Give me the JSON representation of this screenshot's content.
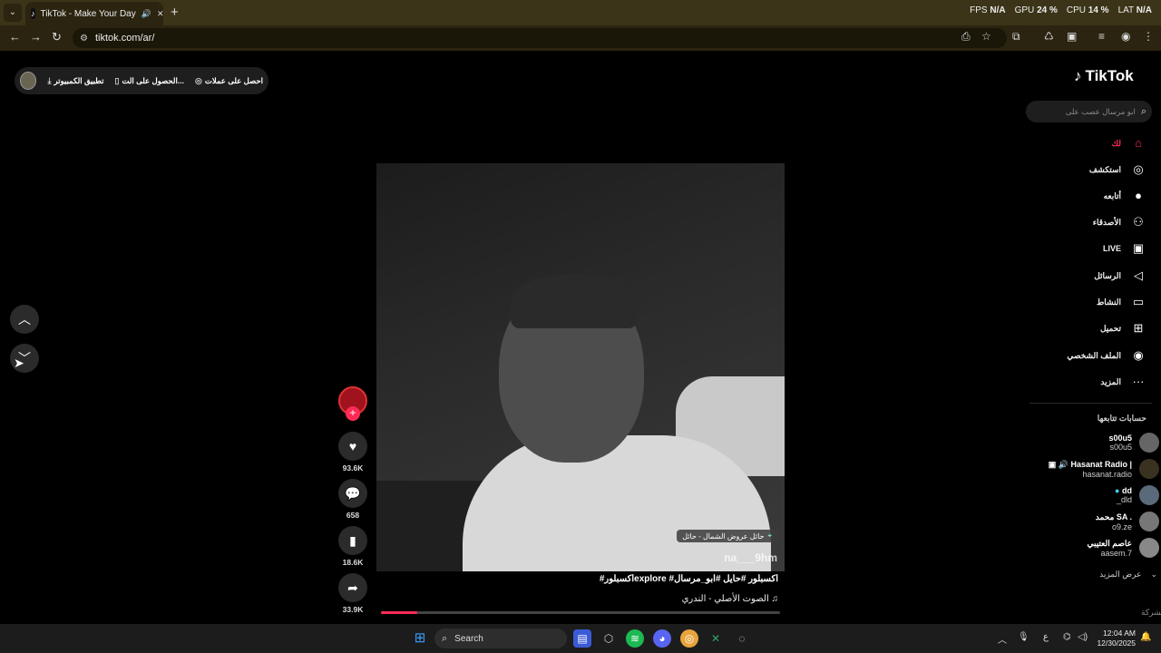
{
  "browser": {
    "tab_title": "TikTok - Make Your Day",
    "url": "tiktok.com/ar/",
    "perf": [
      {
        "label": "FPS",
        "value": "N/A"
      },
      {
        "label": "GPU",
        "value": "24 %"
      },
      {
        "label": "CPU",
        "value": "14 %"
      },
      {
        "label": "LAT",
        "value": "N/A"
      }
    ]
  },
  "top_actions": {
    "desktop_app": "تطبيق الكمبيوتر",
    "get_app": "الحصول على الت...",
    "get_coins": "احصل على عملات"
  },
  "sidebar": {
    "logo": "TikTok",
    "search_placeholder": "ابو مرسال عصب على",
    "nav": [
      {
        "label": "لك",
        "icon": "home-icon"
      },
      {
        "label": "استكشف",
        "icon": "compass-icon"
      },
      {
        "label": "أتابعه",
        "icon": "following-icon"
      },
      {
        "label": "الأصدقاء",
        "icon": "friends-icon"
      },
      {
        "label": "LIVE",
        "icon": "live-icon"
      },
      {
        "label": "الرسائل",
        "icon": "messages-icon"
      },
      {
        "label": "النشاط",
        "icon": "activity-icon"
      },
      {
        "label": "تحميل",
        "icon": "upload-icon"
      },
      {
        "label": "الملف الشخصي",
        "icon": "profile-icon"
      },
      {
        "label": "المزيد",
        "icon": "more-icon"
      }
    ],
    "following_title": "حسابات تتابعها",
    "accounts": [
      {
        "name": "s00u5",
        "handle": "s00u5"
      },
      {
        "name": "Hasanat Radio |",
        "handle": "hasanat.radio"
      },
      {
        "name": "dd",
        "handle": "_dld"
      },
      {
        "name": "محمد SA .",
        "handle": "o9.ze"
      },
      {
        "name": "عاصم العتيبي",
        "handle": "aasem.7"
      }
    ],
    "see_more": "عرض المزيد",
    "company": "الشركة"
  },
  "video": {
    "location": "حائل عروض الشمال - حائل",
    "watermark": "na___9hm",
    "caption": "#اكسبلورexplore #اكسبلور #حايل #ابو_مرسال",
    "sound": "الصوت الأصلي - الندري",
    "progress": 0.09,
    "likes": "93.6K",
    "comments": "658",
    "saves": "18.6K",
    "shares": "33.9K"
  },
  "taskbar": {
    "search_label": "Search",
    "time": "12:04 AM",
    "date": "12/30/2025",
    "lang": "ع"
  }
}
